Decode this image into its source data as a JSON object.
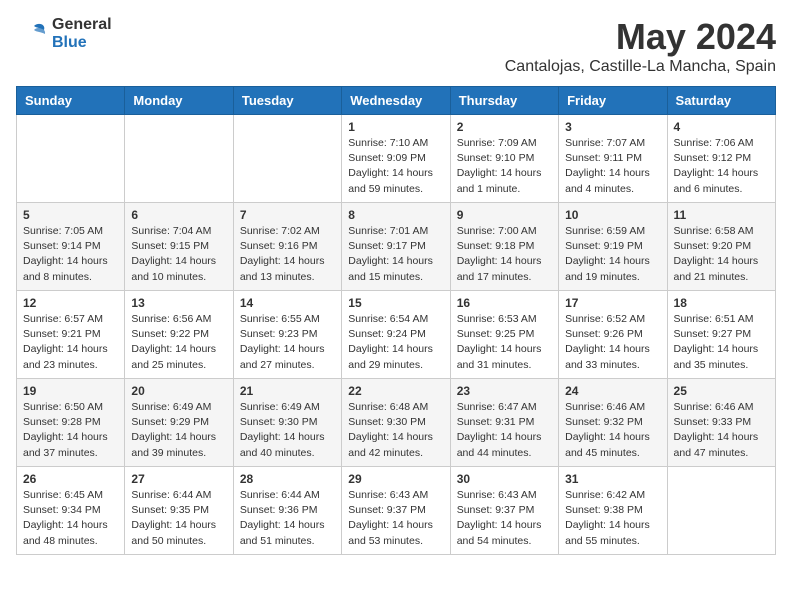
{
  "header": {
    "logo_general": "General",
    "logo_blue": "Blue",
    "title": "May 2024",
    "subtitle": "Cantalojas, Castille-La Mancha, Spain"
  },
  "weekdays": [
    "Sunday",
    "Monday",
    "Tuesday",
    "Wednesday",
    "Thursday",
    "Friday",
    "Saturday"
  ],
  "weeks": [
    [
      {
        "day": "",
        "content": ""
      },
      {
        "day": "",
        "content": ""
      },
      {
        "day": "",
        "content": ""
      },
      {
        "day": "1",
        "content": "Sunrise: 7:10 AM\nSunset: 9:09 PM\nDaylight: 14 hours and 59 minutes."
      },
      {
        "day": "2",
        "content": "Sunrise: 7:09 AM\nSunset: 9:10 PM\nDaylight: 14 hours and 1 minute."
      },
      {
        "day": "3",
        "content": "Sunrise: 7:07 AM\nSunset: 9:11 PM\nDaylight: 14 hours and 4 minutes."
      },
      {
        "day": "4",
        "content": "Sunrise: 7:06 AM\nSunset: 9:12 PM\nDaylight: 14 hours and 6 minutes."
      }
    ],
    [
      {
        "day": "5",
        "content": "Sunrise: 7:05 AM\nSunset: 9:14 PM\nDaylight: 14 hours and 8 minutes."
      },
      {
        "day": "6",
        "content": "Sunrise: 7:04 AM\nSunset: 9:15 PM\nDaylight: 14 hours and 10 minutes."
      },
      {
        "day": "7",
        "content": "Sunrise: 7:02 AM\nSunset: 9:16 PM\nDaylight: 14 hours and 13 minutes."
      },
      {
        "day": "8",
        "content": "Sunrise: 7:01 AM\nSunset: 9:17 PM\nDaylight: 14 hours and 15 minutes."
      },
      {
        "day": "9",
        "content": "Sunrise: 7:00 AM\nSunset: 9:18 PM\nDaylight: 14 hours and 17 minutes."
      },
      {
        "day": "10",
        "content": "Sunrise: 6:59 AM\nSunset: 9:19 PM\nDaylight: 14 hours and 19 minutes."
      },
      {
        "day": "11",
        "content": "Sunrise: 6:58 AM\nSunset: 9:20 PM\nDaylight: 14 hours and 21 minutes."
      }
    ],
    [
      {
        "day": "12",
        "content": "Sunrise: 6:57 AM\nSunset: 9:21 PM\nDaylight: 14 hours and 23 minutes."
      },
      {
        "day": "13",
        "content": "Sunrise: 6:56 AM\nSunset: 9:22 PM\nDaylight: 14 hours and 25 minutes."
      },
      {
        "day": "14",
        "content": "Sunrise: 6:55 AM\nSunset: 9:23 PM\nDaylight: 14 hours and 27 minutes."
      },
      {
        "day": "15",
        "content": "Sunrise: 6:54 AM\nSunset: 9:24 PM\nDaylight: 14 hours and 29 minutes."
      },
      {
        "day": "16",
        "content": "Sunrise: 6:53 AM\nSunset: 9:25 PM\nDaylight: 14 hours and 31 minutes."
      },
      {
        "day": "17",
        "content": "Sunrise: 6:52 AM\nSunset: 9:26 PM\nDaylight: 14 hours and 33 minutes."
      },
      {
        "day": "18",
        "content": "Sunrise: 6:51 AM\nSunset: 9:27 PM\nDaylight: 14 hours and 35 minutes."
      }
    ],
    [
      {
        "day": "19",
        "content": "Sunrise: 6:50 AM\nSunset: 9:28 PM\nDaylight: 14 hours and 37 minutes."
      },
      {
        "day": "20",
        "content": "Sunrise: 6:49 AM\nSunset: 9:29 PM\nDaylight: 14 hours and 39 minutes."
      },
      {
        "day": "21",
        "content": "Sunrise: 6:49 AM\nSunset: 9:30 PM\nDaylight: 14 hours and 40 minutes."
      },
      {
        "day": "22",
        "content": "Sunrise: 6:48 AM\nSunset: 9:30 PM\nDaylight: 14 hours and 42 minutes."
      },
      {
        "day": "23",
        "content": "Sunrise: 6:47 AM\nSunset: 9:31 PM\nDaylight: 14 hours and 44 minutes."
      },
      {
        "day": "24",
        "content": "Sunrise: 6:46 AM\nSunset: 9:32 PM\nDaylight: 14 hours and 45 minutes."
      },
      {
        "day": "25",
        "content": "Sunrise: 6:46 AM\nSunset: 9:33 PM\nDaylight: 14 hours and 47 minutes."
      }
    ],
    [
      {
        "day": "26",
        "content": "Sunrise: 6:45 AM\nSunset: 9:34 PM\nDaylight: 14 hours and 48 minutes."
      },
      {
        "day": "27",
        "content": "Sunrise: 6:44 AM\nSunset: 9:35 PM\nDaylight: 14 hours and 50 minutes."
      },
      {
        "day": "28",
        "content": "Sunrise: 6:44 AM\nSunset: 9:36 PM\nDaylight: 14 hours and 51 minutes."
      },
      {
        "day": "29",
        "content": "Sunrise: 6:43 AM\nSunset: 9:37 PM\nDaylight: 14 hours and 53 minutes."
      },
      {
        "day": "30",
        "content": "Sunrise: 6:43 AM\nSunset: 9:37 PM\nDaylight: 14 hours and 54 minutes."
      },
      {
        "day": "31",
        "content": "Sunrise: 6:42 AM\nSunset: 9:38 PM\nDaylight: 14 hours and 55 minutes."
      },
      {
        "day": "",
        "content": ""
      }
    ]
  ]
}
